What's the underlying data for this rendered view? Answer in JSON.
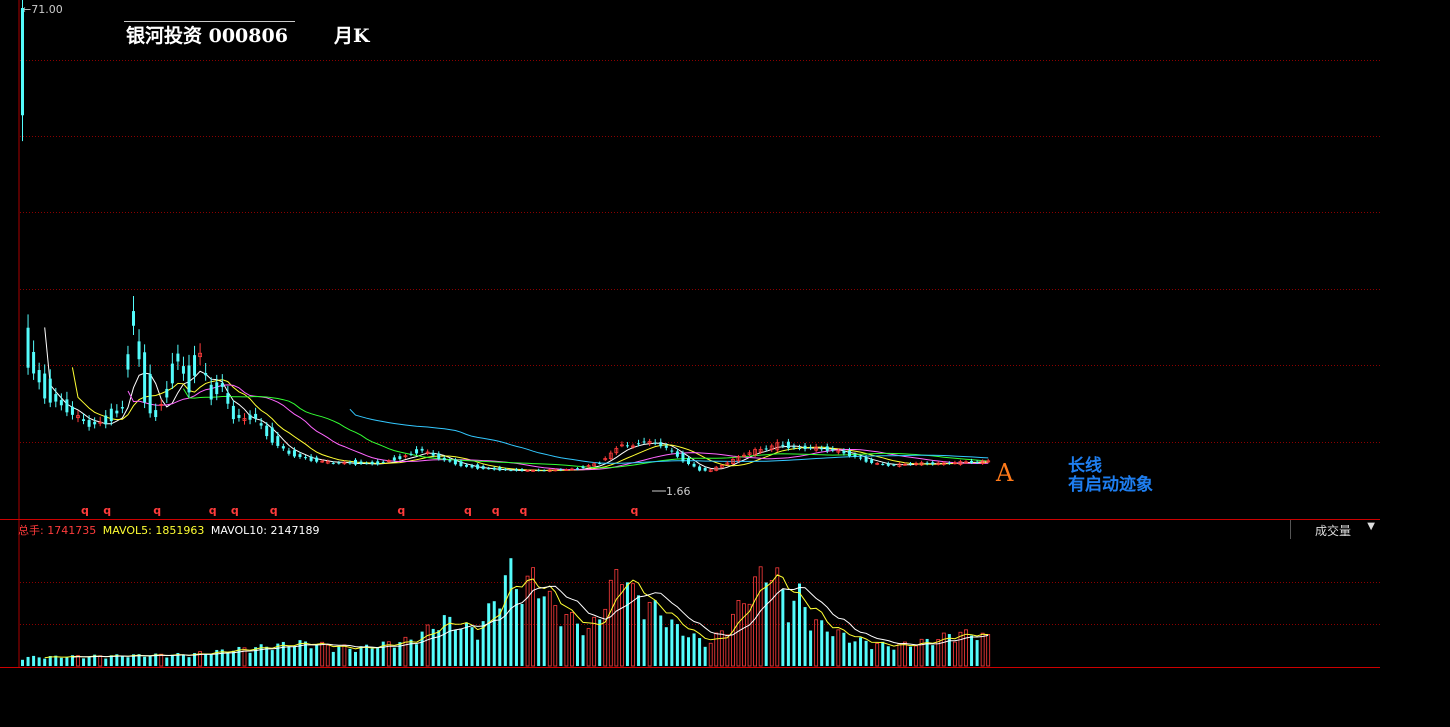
{
  "header": {
    "stock_name": "银河投资 000806",
    "period": "月K"
  },
  "price_axis": {
    "max_label": "71.00",
    "low_label": "1.66"
  },
  "annotation": {
    "marker": "A",
    "line1": "长线",
    "line2": "有启动迹象"
  },
  "volume_panel": {
    "total_label": "总手:",
    "total_value": "1741735",
    "mavol5_label": "MAVOL5:",
    "mavol5_value": "1851963",
    "mavol10_label": "MAVOL10:",
    "mavol10_value": "2147189",
    "indicator_select": "成交量"
  },
  "signal_marker": "q",
  "colors": {
    "up": "#ff3c3c",
    "down": "#54fcfc",
    "grid": "#8b0000",
    "ma5": "#ffffff",
    "ma10": "#ffff33",
    "ma20": "#ff66ff",
    "ma30": "#33ff33",
    "ma60": "#33c8ff",
    "annotation": "#1e7ef0",
    "marker": "#ff7a1a"
  },
  "chart_data": {
    "type": "candlestick",
    "title": "银河投资 000806 月K",
    "ylim": [
      0,
      71
    ],
    "price_anchors": [
      [
        0,
        71,
        55
      ],
      [
        1,
        22,
        18
      ],
      [
        4,
        16,
        13
      ],
      [
        8,
        12,
        11
      ],
      [
        12,
        9,
        8.8
      ],
      [
        15,
        10,
        9
      ],
      [
        18,
        12,
        11
      ],
      [
        20,
        25,
        24
      ],
      [
        22,
        20,
        12
      ],
      [
        24,
        11,
        10
      ],
      [
        26,
        14,
        13
      ],
      [
        28,
        20,
        18
      ],
      [
        30,
        17,
        14
      ],
      [
        32,
        20,
        19
      ],
      [
        34,
        14,
        13
      ],
      [
        36,
        16,
        14
      ],
      [
        38,
        11,
        10
      ],
      [
        40,
        10,
        9.5
      ],
      [
        42,
        10,
        10
      ],
      [
        44,
        9,
        7
      ],
      [
        48,
        5,
        4.5
      ],
      [
        52,
        4,
        3.5
      ],
      [
        56,
        3,
        3.2
      ],
      [
        60,
        3.4,
        3
      ],
      [
        64,
        3.2,
        3
      ],
      [
        68,
        4,
        3.8
      ],
      [
        72,
        5.2,
        5
      ],
      [
        76,
        4,
        3.5
      ],
      [
        80,
        3,
        2.5
      ],
      [
        84,
        2.5,
        2.2
      ],
      [
        88,
        2.2,
        2
      ],
      [
        92,
        2,
        2
      ],
      [
        96,
        2,
        2.1
      ],
      [
        100,
        2.3,
        2.2
      ],
      [
        104,
        3,
        3.2
      ],
      [
        106,
        4,
        4.5
      ],
      [
        108,
        5.5,
        6
      ],
      [
        110,
        6,
        5.5
      ],
      [
        112,
        6,
        6.5
      ],
      [
        114,
        6.5,
        6
      ],
      [
        116,
        5.5,
        5.5
      ],
      [
        118,
        5,
        4
      ],
      [
        120,
        3.8,
        3
      ],
      [
        122,
        2.6,
        2
      ],
      [
        124,
        1.9,
        2.1
      ],
      [
        126,
        2.4,
        2.8
      ],
      [
        128,
        3.2,
        3.6
      ],
      [
        130,
        4,
        4.4
      ],
      [
        132,
        4.6,
        5
      ],
      [
        134,
        5,
        5.3
      ],
      [
        136,
        5.4,
        6
      ],
      [
        138,
        6,
        5.5
      ],
      [
        140,
        5.6,
        5.2
      ],
      [
        142,
        5.3,
        5.5
      ],
      [
        144,
        5.4,
        5.2
      ],
      [
        146,
        5.2,
        5
      ],
      [
        148,
        4.9,
        4.6
      ],
      [
        150,
        4.5,
        4
      ],
      [
        152,
        3.8,
        3.4
      ],
      [
        154,
        3.2,
        3
      ],
      [
        156,
        2.9,
        2.8
      ],
      [
        158,
        2.8,
        2.9
      ],
      [
        160,
        2.9,
        3
      ],
      [
        162,
        3,
        3.1
      ],
      [
        164,
        3.1,
        3
      ],
      [
        166,
        3,
        3.1
      ],
      [
        168,
        3,
        3.2
      ],
      [
        170,
        3.2,
        3.3
      ],
      [
        172,
        3.3,
        3.2
      ],
      [
        174,
        3.2,
        3.5
      ]
    ],
    "candle_count": 175,
    "volume_anchors": [
      [
        0,
        30
      ],
      [
        30,
        40
      ],
      [
        40,
        60
      ],
      [
        50,
        80
      ],
      [
        60,
        60
      ],
      [
        70,
        90
      ],
      [
        76,
        160
      ],
      [
        82,
        120
      ],
      [
        86,
        260
      ],
      [
        88,
        330
      ],
      [
        90,
        250
      ],
      [
        92,
        310
      ],
      [
        96,
        200
      ],
      [
        100,
        150
      ],
      [
        102,
        120
      ],
      [
        104,
        180
      ],
      [
        108,
        350
      ],
      [
        110,
        250
      ],
      [
        114,
        200
      ],
      [
        118,
        130
      ],
      [
        122,
        90
      ],
      [
        124,
        80
      ],
      [
        126,
        120
      ],
      [
        128,
        170
      ],
      [
        130,
        230
      ],
      [
        132,
        280
      ],
      [
        134,
        340
      ],
      [
        136,
        300
      ],
      [
        138,
        200
      ],
      [
        140,
        250
      ],
      [
        142,
        160
      ],
      [
        146,
        120
      ],
      [
        150,
        90
      ],
      [
        156,
        70
      ],
      [
        160,
        75
      ],
      [
        164,
        90
      ],
      [
        166,
        100
      ],
      [
        168,
        115
      ],
      [
        170,
        110
      ],
      [
        172,
        110
      ],
      [
        174,
        98
      ]
    ],
    "volume_max": 440,
    "signal_positions": [
      11,
      15,
      24,
      34,
      38,
      45,
      68,
      80,
      85,
      90,
      110
    ]
  }
}
